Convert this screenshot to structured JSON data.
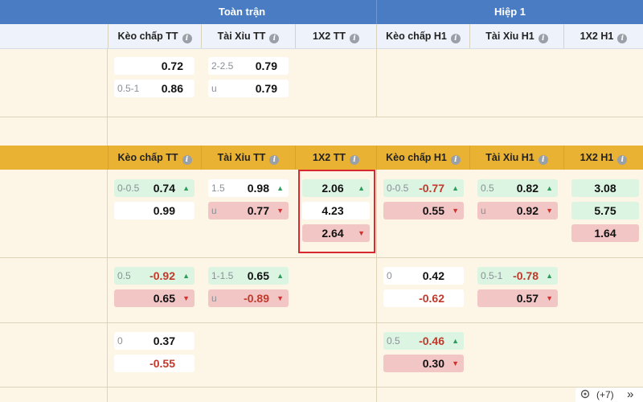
{
  "groups": {
    "full": "Toàn trận",
    "half": "Hiệp 1"
  },
  "columns": [
    "Kèo chấp TT",
    "Tài Xỉu TT",
    "1X2 TT",
    "Kèo chấp H1",
    "Tài Xỉu H1",
    "1X2 H1"
  ],
  "info_glyph": "i",
  "section1": {
    "handicap": [
      {
        "label": "",
        "value": "0.72"
      },
      {
        "label": "0.5-1",
        "value": "0.86"
      }
    ],
    "overunder": [
      {
        "label": "2-2.5",
        "value": "0.79"
      },
      {
        "label": "u",
        "value": "0.79"
      }
    ]
  },
  "section2": {
    "row1": {
      "handicap_tt": [
        {
          "label": "0-0.5",
          "value": "0.74",
          "trend": "up"
        },
        {
          "label": "",
          "value": "0.99",
          "trend": ""
        }
      ],
      "overunder_tt": [
        {
          "label": "1.5",
          "value": "0.98",
          "trend": "up"
        },
        {
          "label": "u",
          "value": "0.77",
          "trend": "down"
        }
      ],
      "x12_tt": [
        {
          "value": "2.06",
          "trend": "up"
        },
        {
          "value": "4.23",
          "trend": ""
        },
        {
          "value": "2.64",
          "trend": "down"
        }
      ],
      "handicap_h1": [
        {
          "label": "0-0.5",
          "value": "-0.77",
          "trend": "up"
        },
        {
          "label": "",
          "value": "0.55",
          "trend": "down"
        }
      ],
      "overunder_h1": [
        {
          "label": "0.5",
          "value": "0.82",
          "trend": "up"
        },
        {
          "label": "u",
          "value": "0.92",
          "trend": "down"
        }
      ],
      "x12_h1": [
        {
          "value": "3.08",
          "trend": ""
        },
        {
          "value": "5.75",
          "trend": ""
        },
        {
          "value": "1.64",
          "trend": ""
        }
      ]
    },
    "row2": {
      "handicap_tt": [
        {
          "label": "0.5",
          "value": "-0.92",
          "trend": "up"
        },
        {
          "label": "",
          "value": "0.65",
          "trend": "down"
        }
      ],
      "overunder_tt": [
        {
          "label": "1-1.5",
          "value": "0.65",
          "trend": "up"
        },
        {
          "label": "u",
          "value": "-0.89",
          "trend": "down"
        }
      ],
      "handicap_h1": [
        {
          "label": "0",
          "value": "0.42",
          "trend": ""
        },
        {
          "label": "",
          "value": "-0.62",
          "trend": ""
        }
      ],
      "overunder_h1": [
        {
          "label": "0.5-1",
          "value": "-0.78",
          "trend": "up"
        },
        {
          "label": "",
          "value": "0.57",
          "trend": "down"
        }
      ]
    },
    "row3": {
      "handicap_tt": [
        {
          "label": "0",
          "value": "0.37",
          "trend": ""
        },
        {
          "label": "",
          "value": "-0.55",
          "trend": ""
        }
      ],
      "handicap_h1": [
        {
          "label": "0.5",
          "value": "-0.46",
          "trend": "up"
        },
        {
          "label": "",
          "value": "0.30",
          "trend": "down"
        }
      ]
    }
  },
  "footer": {
    "more": "(+7)",
    "arrows": "»"
  },
  "arrows": {
    "up": "▲",
    "down": "▼"
  },
  "colors": {
    "header_blue": "#4a7cc4",
    "header_gold": "#eab232",
    "up": "#2e9c5a",
    "down": "#d0322e",
    "highlight": "#d7292f"
  }
}
